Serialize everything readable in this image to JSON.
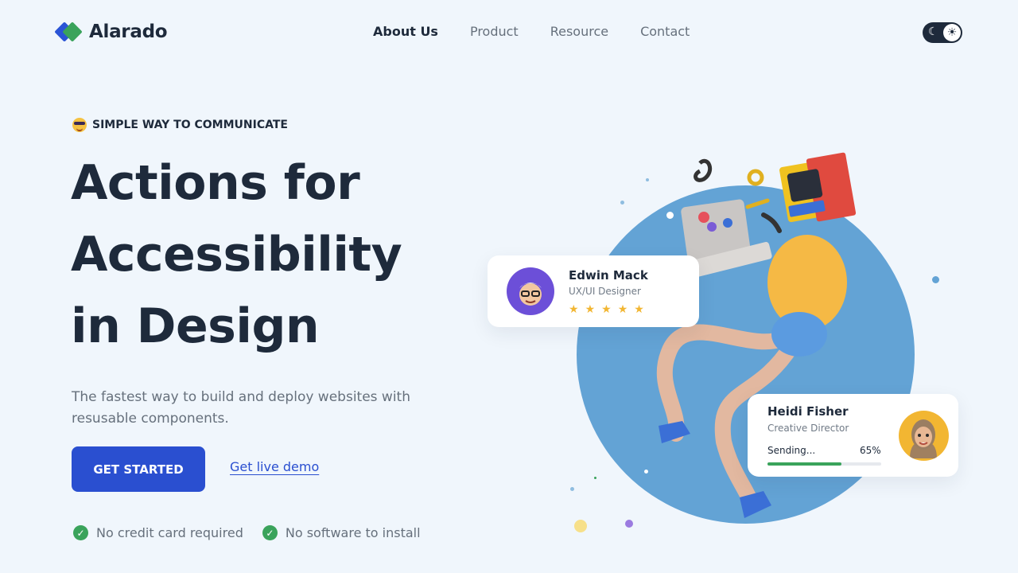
{
  "header": {
    "brand": "Alarado",
    "nav": [
      {
        "label": "About Us",
        "active": true
      },
      {
        "label": "Product",
        "active": false
      },
      {
        "label": "Resource",
        "active": false
      },
      {
        "label": "Contact",
        "active": false
      }
    ],
    "theme_toggle": {
      "state": "light"
    }
  },
  "hero": {
    "eyebrow": "SIMPLE WAY TO COMMUNICATE",
    "headline": [
      "Actions for",
      "Accessibility",
      "in Design"
    ],
    "subtitle": "The fastest way to build and deploy websites with resusable components.",
    "cta_primary": "GET STARTED",
    "cta_secondary": "Get live demo",
    "checks": [
      "No credit card required",
      "No software to install"
    ]
  },
  "cards": {
    "edwin": {
      "name": "Edwin Mack",
      "role": "UX/UI Designer",
      "rating": 5
    },
    "heidi": {
      "name": "Heidi Fisher",
      "role": "Creative Director",
      "progress_label": "Sending...",
      "progress_text": "65%",
      "progress": 0.65
    }
  },
  "colors": {
    "primary": "#2a4fd0",
    "success": "#3aa35b",
    "star": "#f2b632",
    "circle": "#63a3d5",
    "heading": "#1e2a3b",
    "background": "#f0f6fc"
  }
}
